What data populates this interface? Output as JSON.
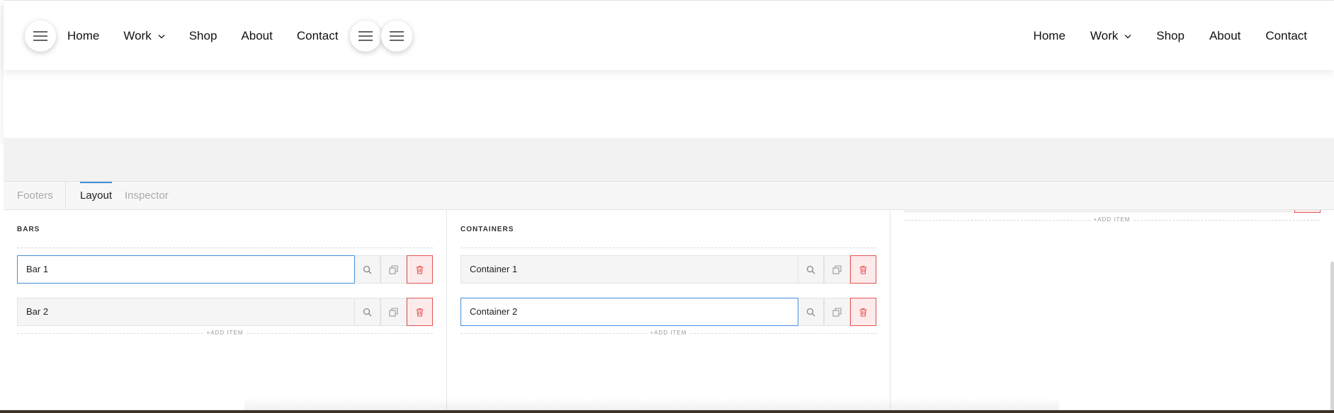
{
  "preview": {
    "nav_left": {
      "items": [
        {
          "label": "Home"
        },
        {
          "label": "Work",
          "has_dropdown": true
        },
        {
          "label": "Shop"
        },
        {
          "label": "About"
        },
        {
          "label": "Contact"
        }
      ]
    },
    "nav_right": {
      "items": [
        {
          "label": "Home"
        },
        {
          "label": "Work",
          "has_dropdown": true
        },
        {
          "label": "Shop"
        },
        {
          "label": "About"
        },
        {
          "label": "Contact"
        }
      ]
    },
    "icons": {
      "menu": "hamburger-icon",
      "dropdown": "chevron-down-icon"
    }
  },
  "editor": {
    "tabs": [
      {
        "label": "Footers",
        "active": false
      },
      {
        "label": "Layout",
        "active": true
      },
      {
        "label": "Inspector",
        "active": false
      }
    ],
    "bars": {
      "title": "BARS",
      "items": [
        {
          "label": "Bar 1",
          "selected": true
        },
        {
          "label": "Bar 2",
          "selected": false
        }
      ],
      "add_label": "+ADD ITEM"
    },
    "containers": {
      "title": "CONTAINERS",
      "items": [
        {
          "label": "Container 1",
          "selected": false
        },
        {
          "label": "Container 2",
          "selected": true
        }
      ],
      "add_label": "+ADD ITEM"
    },
    "third_column": {
      "add_label": "+ADD ITEM"
    },
    "row_icons": {
      "search": "search-icon",
      "duplicate": "duplicate-icon",
      "delete": "trash-icon"
    },
    "colors": {
      "accent": "#3f8fd8",
      "danger": "#e35454",
      "danger_bg": "#fdeaea"
    }
  }
}
